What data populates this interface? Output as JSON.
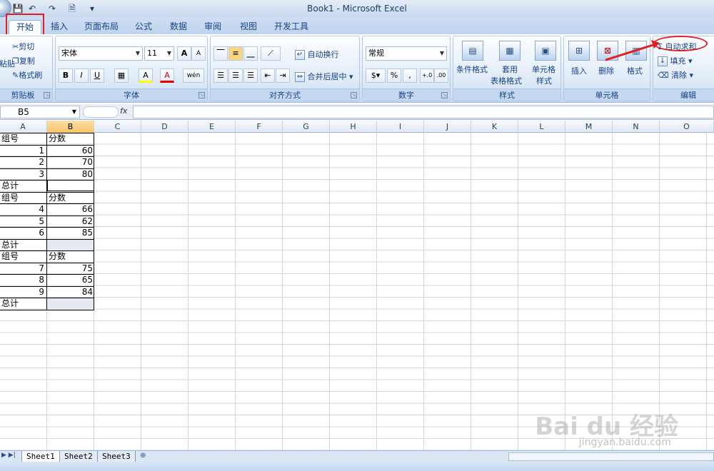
{
  "window": {
    "title": "Book1 - Microsoft Excel"
  },
  "quick_access": {
    "save": "💾",
    "undo": "↶",
    "redo": "↷",
    "print_preview": "🗎",
    "customize": "▾"
  },
  "tabs": [
    "开始",
    "插入",
    "页面布局",
    "公式",
    "数据",
    "审阅",
    "视图",
    "开发工具"
  ],
  "active_tab": "开始",
  "ribbon": {
    "clipboard": {
      "label": "剪贴板",
      "paste": "粘贴",
      "cut": "剪切",
      "copy": "复制",
      "format_painter": "格式刷"
    },
    "font": {
      "label": "字体",
      "name": "宋体",
      "size": "11",
      "grow": "A",
      "shrink": "A",
      "bold": "B",
      "italic": "I",
      "underline": "U",
      "border": "▦",
      "fill": "A",
      "color": "A",
      "phonetic": "wén"
    },
    "alignment": {
      "label": "对齐方式",
      "wrap": "自动换行",
      "merge": "合并后居中"
    },
    "number": {
      "label": "数字",
      "format": "常规",
      "percent": "%",
      "comma": ",",
      "inc_dec": "+.0",
      "dec_dec": ".00"
    },
    "styles": {
      "label": "样式",
      "conditional": "条件格式",
      "table_line1": "套用",
      "table_line2": "表格格式",
      "cell_styles_line1": "单元格",
      "cell_styles_line2": "样式"
    },
    "cells": {
      "label": "单元格",
      "insert": "插入",
      "delete": "删除",
      "format": "格式"
    },
    "editing": {
      "label": "编辑",
      "autosum": "自动求和",
      "fill": "填充",
      "clear": "清除",
      "sigma": "Σ"
    }
  },
  "formula_bar": {
    "name_box": "B5",
    "fx": "fx",
    "value": ""
  },
  "columns": [
    "A",
    "B",
    "C",
    "D",
    "E",
    "F",
    "G",
    "H",
    "I",
    "J",
    "K",
    "L",
    "M",
    "N",
    "O"
  ],
  "selected_column": "B",
  "sheet": {
    "rows": [
      [
        "组号",
        "分数"
      ],
      [
        "1",
        "60"
      ],
      [
        "2",
        "70"
      ],
      [
        "3",
        "80"
      ],
      [
        "总计",
        ""
      ],
      [
        "组号",
        "分数"
      ],
      [
        "4",
        "66"
      ],
      [
        "5",
        "62"
      ],
      [
        "6",
        "85"
      ],
      [
        "总计",
        ""
      ],
      [
        "组号",
        "分数"
      ],
      [
        "7",
        "75"
      ],
      [
        "8",
        "65"
      ],
      [
        "9",
        "84"
      ],
      [
        "总计",
        ""
      ]
    ]
  },
  "sheet_tabs": [
    "Sheet1",
    "Sheet2",
    "Sheet3"
  ],
  "colors": {
    "highlight": "#e02020",
    "accent": "#15428b"
  },
  "watermark": {
    "main": "Bai du 经验",
    "sub": "jingyan.baidu.com"
  }
}
